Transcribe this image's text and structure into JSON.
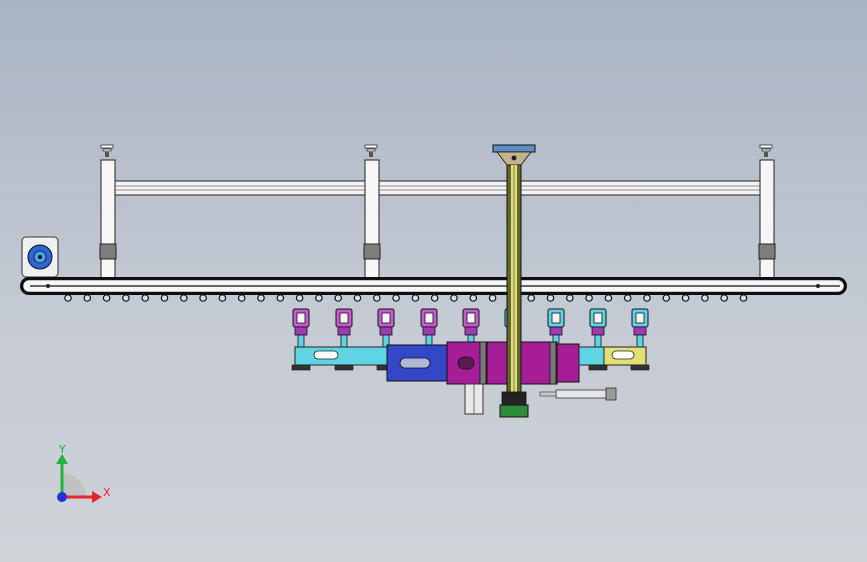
{
  "viewport": {
    "background_top": "#a9b4c3",
    "background_bottom": "#d0d3d8"
  },
  "axis_triad": {
    "x_label": "X",
    "y_label": "Y",
    "x_color": "#e8262c",
    "y_color": "#23b23c",
    "z_color": "#2430d8"
  },
  "model": {
    "frame_color": "#f4f4f4",
    "rail_color": "#0e0e12",
    "carriage_colors": [
      "#5ed4e4",
      "#3447c9",
      "#a61e96",
      "#e0e074",
      "#c65bd0"
    ],
    "column_color": "#5f6a2a"
  }
}
